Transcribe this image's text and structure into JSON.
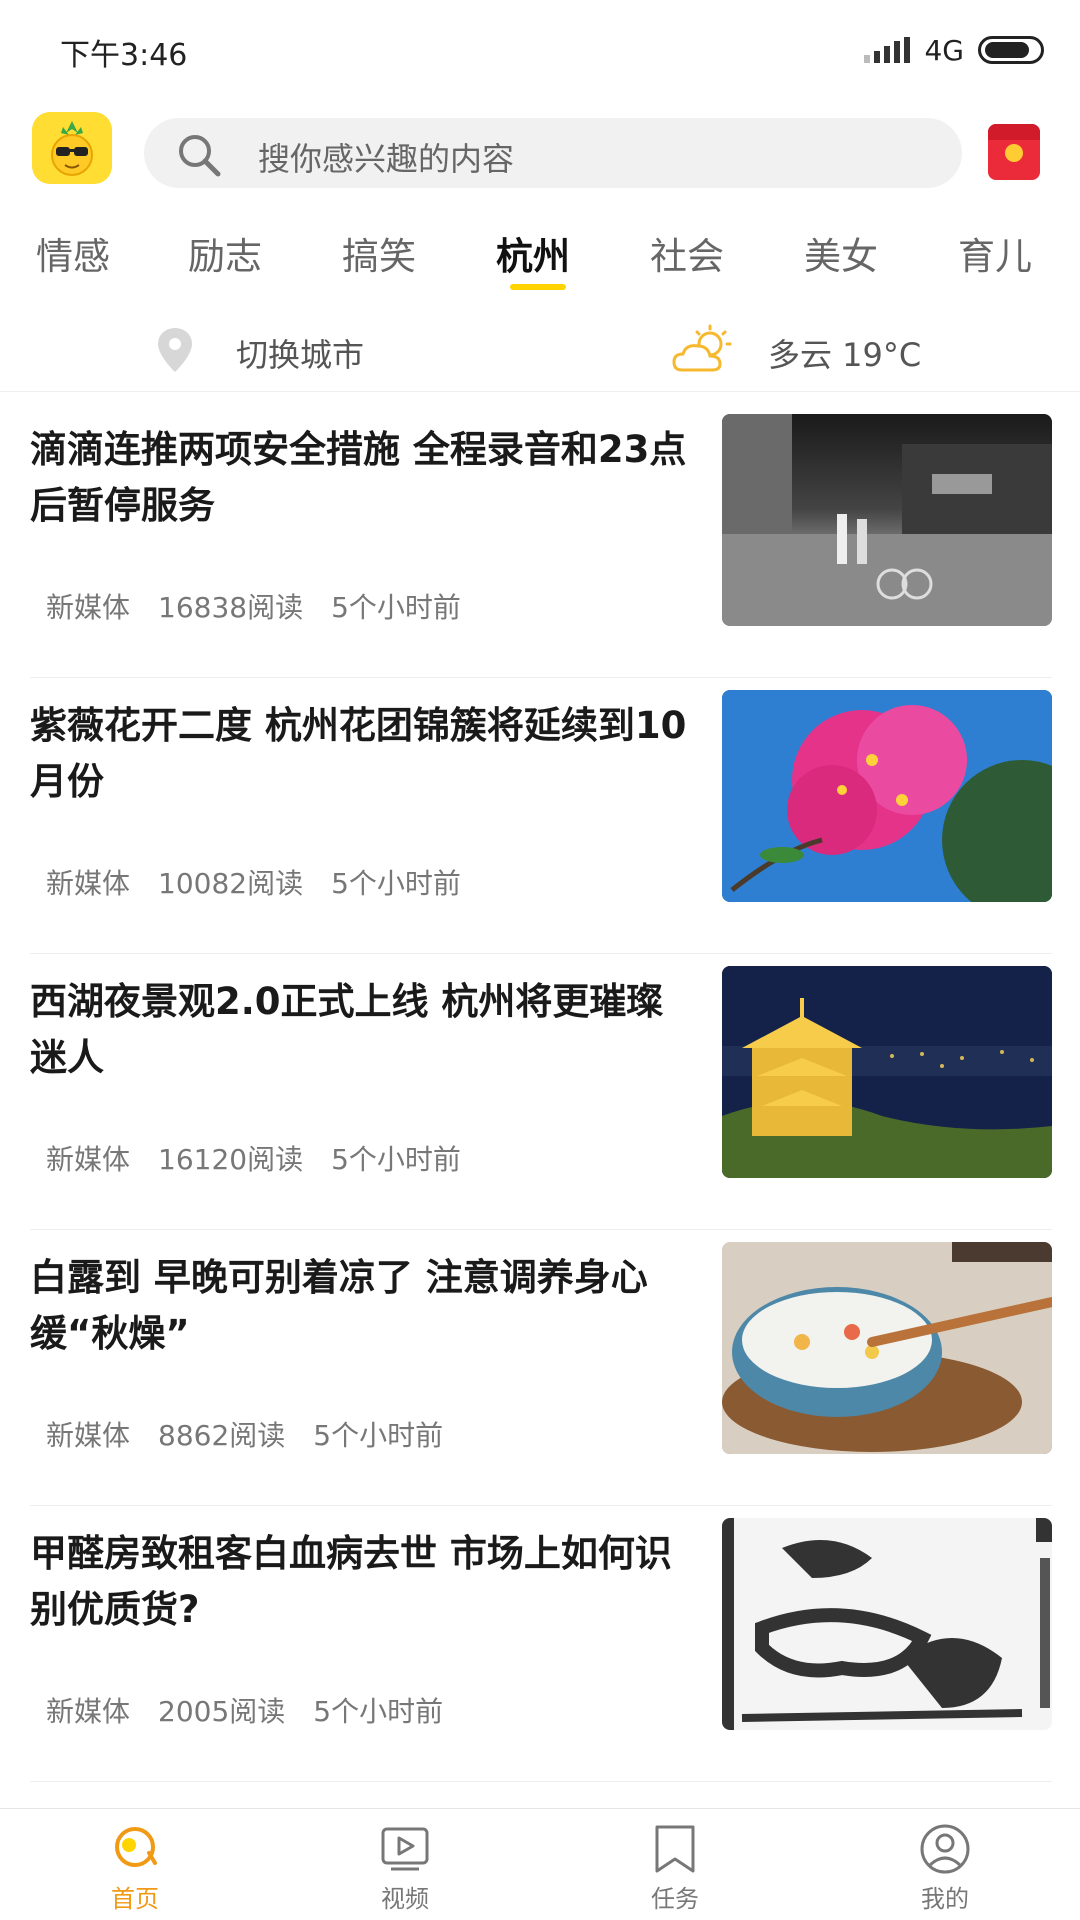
{
  "status_bar": {
    "time": "下午3:46",
    "network": "4G"
  },
  "search": {
    "placeholder": "搜你感兴趣的内容"
  },
  "tabs": [
    {
      "label": "情感",
      "active": false
    },
    {
      "label": "励志",
      "active": false
    },
    {
      "label": "搞笑",
      "active": false
    },
    {
      "label": "杭州",
      "active": true
    },
    {
      "label": "社会",
      "active": false
    },
    {
      "label": "美女",
      "active": false
    },
    {
      "label": "育儿",
      "active": false
    }
  ],
  "city_bar": {
    "switch_city": "切换城市",
    "weather": "多云 19°C"
  },
  "articles": [
    {
      "title": "滴滴连推两项安全措施 全程录音和23点后暂停服务",
      "source": "新媒体",
      "reads": "16838阅读",
      "time": "5个小时前"
    },
    {
      "title": "紫薇花开二度 杭州花团锦簇将延续到10月份",
      "source": "新媒体",
      "reads": "10082阅读",
      "time": "5个小时前"
    },
    {
      "title": "西湖夜景观2.0正式上线 杭州将更璀璨迷人",
      "source": "新媒体",
      "reads": "16120阅读",
      "time": "5个小时前"
    },
    {
      "title": "白露到 早晚可别着凉了 注意调养身心缓“秋燥”",
      "source": "新媒体",
      "reads": "8862阅读",
      "time": "5个小时前"
    },
    {
      "title": "甲醛房致租客白血病去世 市场上如何识别优质货?",
      "source": "新媒体",
      "reads": "2005阅读",
      "time": "5个小时前"
    }
  ],
  "bottom_nav": [
    {
      "label": "首页",
      "active": true
    },
    {
      "label": "视频",
      "active": false
    },
    {
      "label": "任务",
      "active": false
    },
    {
      "label": "我的",
      "active": false
    }
  ],
  "colors": {
    "accent": "#f09a15",
    "tab_indicator": "#ffd400",
    "logo_bg": "#ffdd33",
    "redpack": "#ec2b3a"
  }
}
